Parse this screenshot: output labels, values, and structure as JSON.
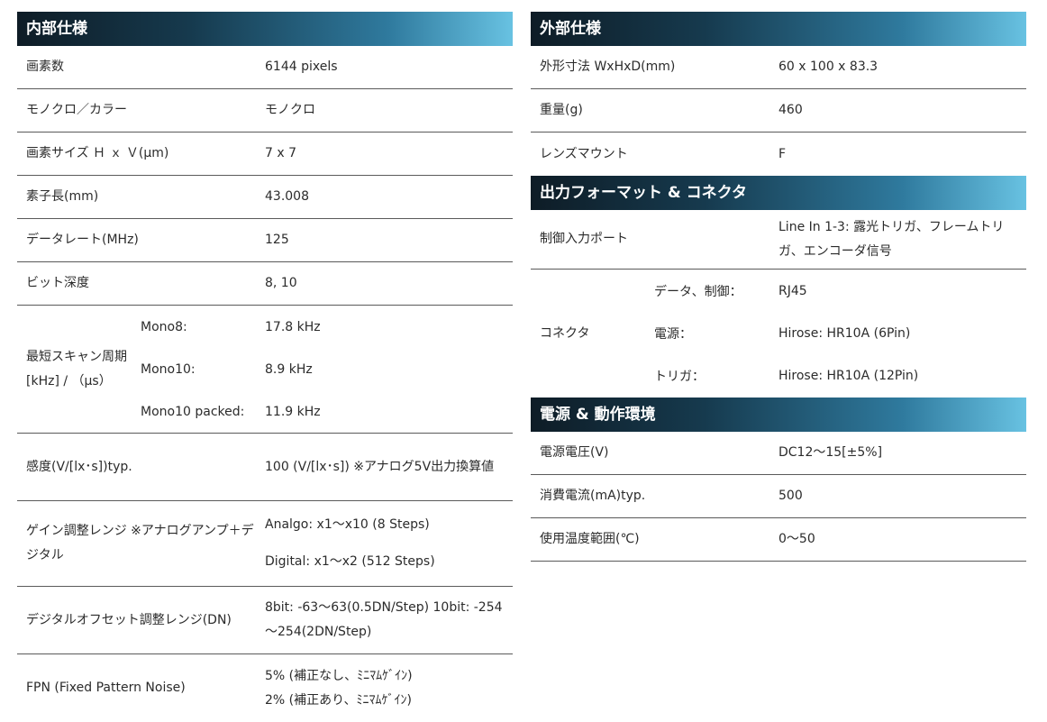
{
  "internal": {
    "title": "内部仕様",
    "pixels": {
      "label": "画素数",
      "value": "6144 pixels"
    },
    "mono_color": {
      "label": "モノクロ／カラー",
      "value": "モノクロ"
    },
    "pixel_size": {
      "label": "画素サイズ Ｈ ｘ Ｖ(μm)",
      "value": "7 x 7"
    },
    "sensor_length": {
      "label": "素子長(mm)",
      "value": "43.008"
    },
    "data_rate": {
      "label": "データレート(MHz)",
      "value": "125"
    },
    "bit_depth": {
      "label": "ビット深度",
      "value": "8, 10"
    },
    "scan": {
      "label": "最短スキャン周期 [kHz] / （μs）",
      "rows": [
        {
          "mode": "Mono8:",
          "value": "17.8 kHz"
        },
        {
          "mode": "Mono10:",
          "value": "8.9 kHz"
        },
        {
          "mode": "Mono10 packed:",
          "value": "11.9 kHz"
        }
      ]
    },
    "sensitivity": {
      "label": "感度(V/[lx･s])typ.",
      "value": "100 (V/[lx･s]) ※アナログ5V出力換算値"
    },
    "gain": {
      "label": "ゲイン調整レンジ ※アナログアンプ＋デジタル",
      "analog": "Analgo: x1～x10 (8 Steps)",
      "digital": "Digital: x1～x2 (512 Steps)"
    },
    "offset": {
      "label": "デジタルオフセット調整レンジ(DN)",
      "value": "8bit: -63～63(0.5DN/Step) 10bit: -254～254(2DN/Step)"
    },
    "fpn": {
      "label": "FPN (Fixed Pattern Noise)",
      "value1": "5% (補正なし、ﾐﾆﾏﾑｹﾞｲﾝ)",
      "value2": "2% (補正あり、ﾐﾆﾏﾑｹﾞｲﾝ)"
    }
  },
  "external": {
    "title": "外部仕様",
    "dimensions": {
      "label": "外形寸法 WxHxD(mm)",
      "value": "60 x 100 x 83.3"
    },
    "weight": {
      "label": "重量(g)",
      "value": "460"
    },
    "mount": {
      "label": "レンズマウント",
      "value": "F"
    }
  },
  "output": {
    "title": "出力フォーマット & コネクタ",
    "control_port": {
      "label": "制御入力ポート",
      "value": "Line In 1-3: 露光トリガ、フレームトリガ、エンコーダ信号"
    },
    "connector": {
      "label": "コネクタ",
      "rows": [
        {
          "name": "データ、制御：",
          "value": "RJ45"
        },
        {
          "name": "電源：",
          "value": "Hirose: HR10A (6Pin)"
        },
        {
          "name": "トリガ：",
          "value": "Hirose: HR10A (12Pin)"
        }
      ]
    }
  },
  "power": {
    "title": "電源 & 動作環境",
    "voltage": {
      "label": "電源電圧(V)",
      "value": "DC12～15[±5%]"
    },
    "current": {
      "label": "消費電流(mA)typ.",
      "value": "500"
    },
    "temp": {
      "label": "使用温度範囲(℃)",
      "value": "0～50"
    }
  }
}
